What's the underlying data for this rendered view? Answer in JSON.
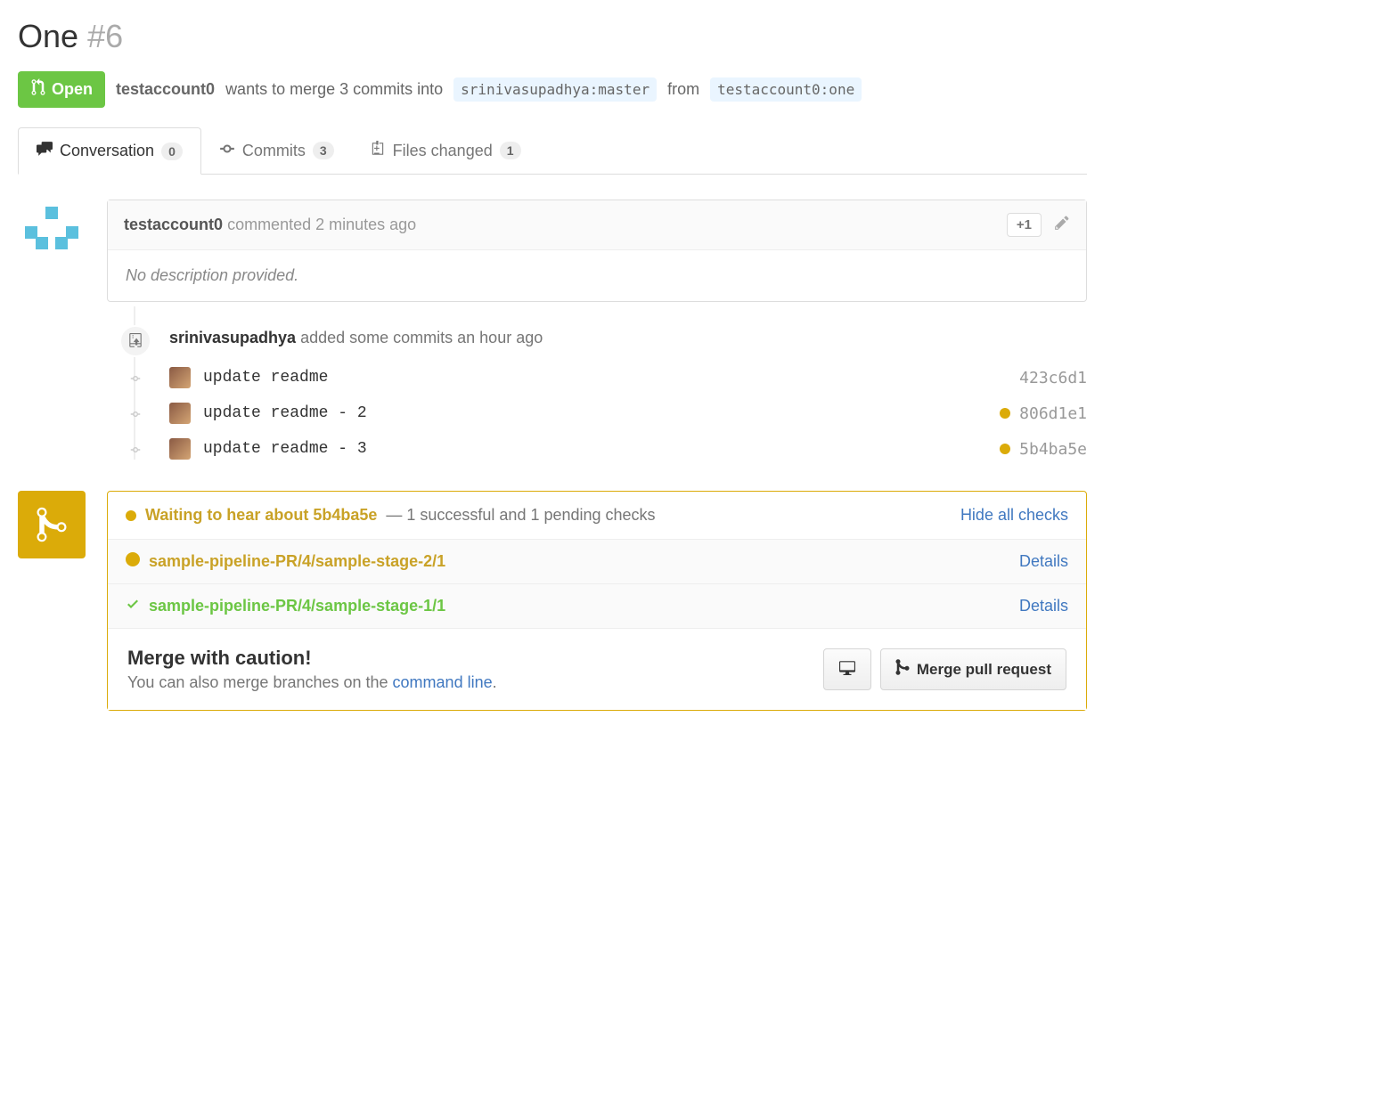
{
  "pr": {
    "title": "One",
    "number": "#6",
    "state": "Open",
    "author": "testaccount0",
    "merge_text": "wants to merge 3 commits into",
    "base_branch": "srinivasupadhya:master",
    "from_text": "from",
    "head_branch": "testaccount0:one"
  },
  "tabs": {
    "conversation": {
      "label": "Conversation",
      "count": "0"
    },
    "commits": {
      "label": "Commits",
      "count": "3"
    },
    "files": {
      "label": "Files changed",
      "count": "1"
    }
  },
  "comment": {
    "user": "testaccount0",
    "rest": "commented 2 minutes ago",
    "reaction": "+1",
    "body": "No description provided."
  },
  "timeline": {
    "user": "srinivasupadhya",
    "rest": "added some commits an hour ago"
  },
  "commits": [
    {
      "msg": "update readme",
      "sha": "423c6d1",
      "status": "none"
    },
    {
      "msg": "update readme - 2",
      "sha": "806d1e1",
      "status": "pending"
    },
    {
      "msg": "update readme - 3",
      "sha": "5b4ba5e",
      "status": "pending"
    }
  ],
  "checks": {
    "summary_title": "Waiting to hear about 5b4ba5e",
    "summary_sub": "— 1 successful and 1 pending checks",
    "hide": "Hide all checks",
    "details": "Details",
    "items": [
      {
        "name": "sample-pipeline-PR/4/sample-stage-2/1",
        "status": "pending"
      },
      {
        "name": "sample-pipeline-PR/4/sample-stage-1/1",
        "status": "success"
      }
    ]
  },
  "merge": {
    "title": "Merge with caution!",
    "sub_prefix": "You can also merge branches on the ",
    "sub_link": "command line",
    "sub_suffix": ".",
    "button": "Merge pull request"
  }
}
